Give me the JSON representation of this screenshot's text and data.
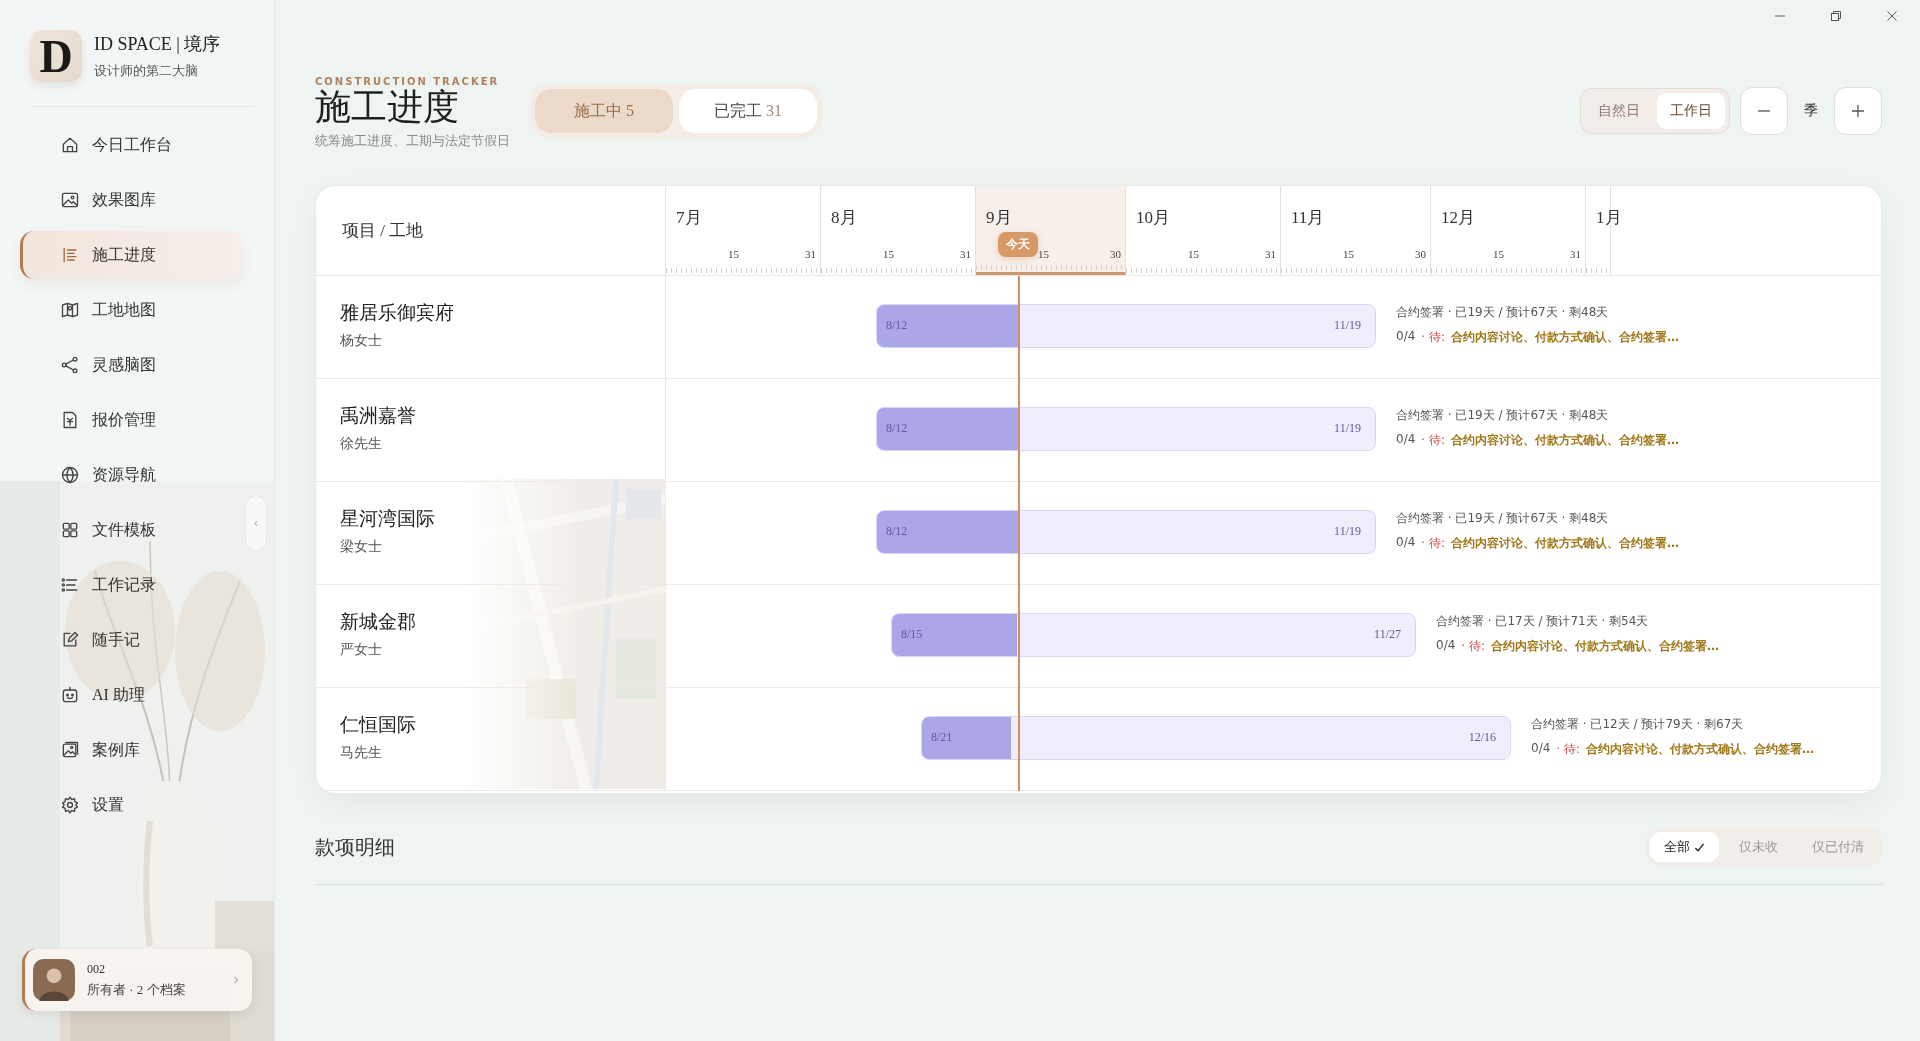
{
  "brand": {
    "logo_letter": "D",
    "name": "ID SPACE | 境序",
    "tagline": "设计师的第二大脑"
  },
  "sidebar": {
    "items": [
      {
        "label": "今日工作台",
        "selected": false
      },
      {
        "label": "效果图库",
        "selected": false
      },
      {
        "label": "施工进度",
        "selected": true
      },
      {
        "label": "工地地图",
        "selected": false
      },
      {
        "label": "灵感脑图",
        "selected": false
      },
      {
        "label": "报价管理",
        "selected": false
      },
      {
        "label": "资源导航",
        "selected": false
      },
      {
        "label": "文件模板",
        "selected": false
      },
      {
        "label": "工作记录",
        "selected": false
      },
      {
        "label": "随手记",
        "selected": false
      },
      {
        "label": "AI 助理",
        "selected": false
      },
      {
        "label": "案例库",
        "selected": false
      },
      {
        "label": "设置",
        "selected": false
      }
    ],
    "collapse_handle": "‹",
    "user": {
      "name": "002",
      "details": "所有者 · 2 个档案"
    }
  },
  "header": {
    "eyebrow": "CONSTRUCTION TRACKER",
    "title": "施工进度",
    "subtitle": "统筹施工进度、工期与法定节假日"
  },
  "status_tabs": [
    {
      "label": "施工中",
      "count": "5",
      "selected": true
    },
    {
      "label": "已完工",
      "count": "31",
      "selected": false
    }
  ],
  "day_mode": [
    {
      "label": "自然日",
      "selected": false
    },
    {
      "label": "工作日",
      "selected": true
    }
  ],
  "scale": {
    "label": "季"
  },
  "gantt": {
    "column_header": "项目 / 工地",
    "today_label": "今天",
    "months": [
      {
        "label": "7月",
        "mid": "15",
        "end": "31",
        "current": false
      },
      {
        "label": "8月",
        "mid": "15",
        "end": "31",
        "current": false
      },
      {
        "label": "9月",
        "mid": "15",
        "end": "30",
        "current": true
      },
      {
        "label": "10月",
        "mid": "15",
        "end": "31",
        "current": false
      },
      {
        "label": "11月",
        "mid": "15",
        "end": "30",
        "current": false
      },
      {
        "label": "12月",
        "mid": "15",
        "end": "31",
        "current": false
      },
      {
        "label": "1月",
        "current": false
      }
    ],
    "rows": [
      {
        "name": "雅居乐御宾府",
        "owner": "杨女士",
        "start": "8/12",
        "end": "11/19",
        "level": 0.284,
        "summary": "合约签署 · 已19天 / 预计67天 · 剩48天",
        "done": "0/4",
        "pending_label": "· 待:",
        "pending": "合约内容讨论、付款方式确认、合约签署…"
      },
      {
        "name": "禹洲嘉誉",
        "owner": "徐先生",
        "start": "8/12",
        "end": "11/19",
        "level": 0.284,
        "summary": "合约签署 · 已19天 / 预计67天 · 剩48天",
        "done": "0/4",
        "pending_label": "· 待:",
        "pending": "合约内容讨论、付款方式确认、合约签署…"
      },
      {
        "name": "星河湾国际",
        "owner": "梁女士",
        "start": "8/12",
        "end": "11/19",
        "level": 0.284,
        "summary": "合约签署 · 已19天 / 预计67天 · 剩48天",
        "done": "0/4",
        "pending_label": "· 待:",
        "pending": "合约内容讨论、付款方式确认、合约签署…"
      },
      {
        "name": "新城金郡",
        "owner": "严女士",
        "start": "8/15",
        "end": "11/27",
        "level": 0.239,
        "summary": "合约签署 · 已17天 / 预计71天 · 剩54天",
        "done": "0/4",
        "pending_label": "· 待:",
        "pending": "合约内容讨论、付款方式确认、合约签署…"
      },
      {
        "name": "仁恒国际",
        "owner": "马先生",
        "start": "8/21",
        "end": "12/16",
        "level": 0.152,
        "summary": "合约签署 · 已12天 / 预计79天 · 剩67天",
        "done": "0/4",
        "pending_label": "· 待:",
        "pending": "合约内容讨论、付款方式确认、合约签署…"
      }
    ]
  },
  "payments": {
    "title": "款项明细",
    "filters": [
      {
        "label": "全部",
        "selected": true
      },
      {
        "label": "仅未收",
        "selected": false
      },
      {
        "label": "仅已付清",
        "selected": false
      }
    ]
  }
}
